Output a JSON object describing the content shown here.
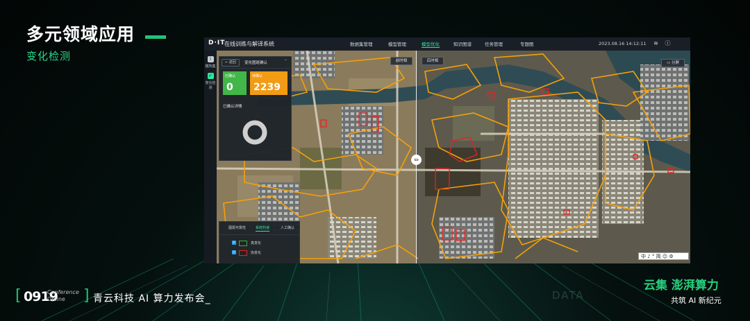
{
  "slide": {
    "title": "多元领域应用",
    "subtitle": "变化检测"
  },
  "app": {
    "logo": "D·IT",
    "name": "在线训练与解译系统",
    "nav": [
      "数据集管理",
      "模型管理",
      "模型优化",
      "知识图谱",
      "任务管理",
      "专题图"
    ],
    "active_nav": "模型优化",
    "datetime": "2023.08.16 14:12:11",
    "accent": "#2ee6a0"
  },
  "leftbar": [
    {
      "label": "模所集",
      "icon": "info-icon"
    },
    {
      "label": "变化检测",
      "icon": "change-detect-icon"
    }
  ],
  "panel": {
    "back_label": "返回",
    "title": "变化图斑确认",
    "confirmed_label": "已确认",
    "confirmed_value": "0",
    "pending_label": "待确认",
    "pending_value": "2239",
    "detail_title": "已确认详情",
    "confirmed_color": "#43b649",
    "pending_color": "#f29b14"
  },
  "map_buttons": {
    "before": "前时相",
    "after": "后时相",
    "share": "分屏"
  },
  "bottom_panel": {
    "tabs": [
      "图斑可靠性",
      "系统判读",
      "人工确认"
    ],
    "active_tab": "系统判读",
    "legend": [
      {
        "label": "真变化",
        "color": "#2fb24a"
      },
      {
        "label": "伪变化",
        "color": "#e52323"
      }
    ]
  },
  "ime": "中 ♪ ° 简 ☺ ⚙",
  "footer": {
    "event_number": "0919",
    "conference": "Conference",
    "online": "Online",
    "event_title": "青云科技 AI 算力发布会_",
    "brand": "云集 澎湃算力",
    "brand_sub": "共筑 AI 新纪元",
    "ghost": "DATA"
  }
}
